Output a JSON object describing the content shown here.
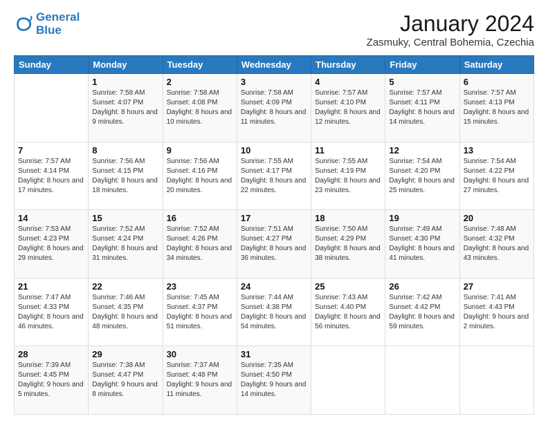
{
  "logo": {
    "line1": "General",
    "line2": "Blue"
  },
  "title": "January 2024",
  "subtitle": "Zasmuky, Central Bohemia, Czechia",
  "weekdays": [
    "Sunday",
    "Monday",
    "Tuesday",
    "Wednesday",
    "Thursday",
    "Friday",
    "Saturday"
  ],
  "weeks": [
    [
      {
        "day": "",
        "sunrise": "",
        "sunset": "",
        "daylight": ""
      },
      {
        "day": "1",
        "sunrise": "Sunrise: 7:58 AM",
        "sunset": "Sunset: 4:07 PM",
        "daylight": "Daylight: 8 hours and 9 minutes."
      },
      {
        "day": "2",
        "sunrise": "Sunrise: 7:58 AM",
        "sunset": "Sunset: 4:08 PM",
        "daylight": "Daylight: 8 hours and 10 minutes."
      },
      {
        "day": "3",
        "sunrise": "Sunrise: 7:58 AM",
        "sunset": "Sunset: 4:09 PM",
        "daylight": "Daylight: 8 hours and 11 minutes."
      },
      {
        "day": "4",
        "sunrise": "Sunrise: 7:57 AM",
        "sunset": "Sunset: 4:10 PM",
        "daylight": "Daylight: 8 hours and 12 minutes."
      },
      {
        "day": "5",
        "sunrise": "Sunrise: 7:57 AM",
        "sunset": "Sunset: 4:11 PM",
        "daylight": "Daylight: 8 hours and 14 minutes."
      },
      {
        "day": "6",
        "sunrise": "Sunrise: 7:57 AM",
        "sunset": "Sunset: 4:13 PM",
        "daylight": "Daylight: 8 hours and 15 minutes."
      }
    ],
    [
      {
        "day": "7",
        "sunrise": "Sunrise: 7:57 AM",
        "sunset": "Sunset: 4:14 PM",
        "daylight": "Daylight: 8 hours and 17 minutes."
      },
      {
        "day": "8",
        "sunrise": "Sunrise: 7:56 AM",
        "sunset": "Sunset: 4:15 PM",
        "daylight": "Daylight: 8 hours and 18 minutes."
      },
      {
        "day": "9",
        "sunrise": "Sunrise: 7:56 AM",
        "sunset": "Sunset: 4:16 PM",
        "daylight": "Daylight: 8 hours and 20 minutes."
      },
      {
        "day": "10",
        "sunrise": "Sunrise: 7:55 AM",
        "sunset": "Sunset: 4:17 PM",
        "daylight": "Daylight: 8 hours and 22 minutes."
      },
      {
        "day": "11",
        "sunrise": "Sunrise: 7:55 AM",
        "sunset": "Sunset: 4:19 PM",
        "daylight": "Daylight: 8 hours and 23 minutes."
      },
      {
        "day": "12",
        "sunrise": "Sunrise: 7:54 AM",
        "sunset": "Sunset: 4:20 PM",
        "daylight": "Daylight: 8 hours and 25 minutes."
      },
      {
        "day": "13",
        "sunrise": "Sunrise: 7:54 AM",
        "sunset": "Sunset: 4:22 PM",
        "daylight": "Daylight: 8 hours and 27 minutes."
      }
    ],
    [
      {
        "day": "14",
        "sunrise": "Sunrise: 7:53 AM",
        "sunset": "Sunset: 4:23 PM",
        "daylight": "Daylight: 8 hours and 29 minutes."
      },
      {
        "day": "15",
        "sunrise": "Sunrise: 7:52 AM",
        "sunset": "Sunset: 4:24 PM",
        "daylight": "Daylight: 8 hours and 31 minutes."
      },
      {
        "day": "16",
        "sunrise": "Sunrise: 7:52 AM",
        "sunset": "Sunset: 4:26 PM",
        "daylight": "Daylight: 8 hours and 34 minutes."
      },
      {
        "day": "17",
        "sunrise": "Sunrise: 7:51 AM",
        "sunset": "Sunset: 4:27 PM",
        "daylight": "Daylight: 8 hours and 36 minutes."
      },
      {
        "day": "18",
        "sunrise": "Sunrise: 7:50 AM",
        "sunset": "Sunset: 4:29 PM",
        "daylight": "Daylight: 8 hours and 38 minutes."
      },
      {
        "day": "19",
        "sunrise": "Sunrise: 7:49 AM",
        "sunset": "Sunset: 4:30 PM",
        "daylight": "Daylight: 8 hours and 41 minutes."
      },
      {
        "day": "20",
        "sunrise": "Sunrise: 7:48 AM",
        "sunset": "Sunset: 4:32 PM",
        "daylight": "Daylight: 8 hours and 43 minutes."
      }
    ],
    [
      {
        "day": "21",
        "sunrise": "Sunrise: 7:47 AM",
        "sunset": "Sunset: 4:33 PM",
        "daylight": "Daylight: 8 hours and 46 minutes."
      },
      {
        "day": "22",
        "sunrise": "Sunrise: 7:46 AM",
        "sunset": "Sunset: 4:35 PM",
        "daylight": "Daylight: 8 hours and 48 minutes."
      },
      {
        "day": "23",
        "sunrise": "Sunrise: 7:45 AM",
        "sunset": "Sunset: 4:37 PM",
        "daylight": "Daylight: 8 hours and 51 minutes."
      },
      {
        "day": "24",
        "sunrise": "Sunrise: 7:44 AM",
        "sunset": "Sunset: 4:38 PM",
        "daylight": "Daylight: 8 hours and 54 minutes."
      },
      {
        "day": "25",
        "sunrise": "Sunrise: 7:43 AM",
        "sunset": "Sunset: 4:40 PM",
        "daylight": "Daylight: 8 hours and 56 minutes."
      },
      {
        "day": "26",
        "sunrise": "Sunrise: 7:42 AM",
        "sunset": "Sunset: 4:42 PM",
        "daylight": "Daylight: 8 hours and 59 minutes."
      },
      {
        "day": "27",
        "sunrise": "Sunrise: 7:41 AM",
        "sunset": "Sunset: 4:43 PM",
        "daylight": "Daylight: 9 hours and 2 minutes."
      }
    ],
    [
      {
        "day": "28",
        "sunrise": "Sunrise: 7:39 AM",
        "sunset": "Sunset: 4:45 PM",
        "daylight": "Daylight: 9 hours and 5 minutes."
      },
      {
        "day": "29",
        "sunrise": "Sunrise: 7:38 AM",
        "sunset": "Sunset: 4:47 PM",
        "daylight": "Daylight: 9 hours and 8 minutes."
      },
      {
        "day": "30",
        "sunrise": "Sunrise: 7:37 AM",
        "sunset": "Sunset: 4:48 PM",
        "daylight": "Daylight: 9 hours and 11 minutes."
      },
      {
        "day": "31",
        "sunrise": "Sunrise: 7:35 AM",
        "sunset": "Sunset: 4:50 PM",
        "daylight": "Daylight: 9 hours and 14 minutes."
      },
      {
        "day": "",
        "sunrise": "",
        "sunset": "",
        "daylight": ""
      },
      {
        "day": "",
        "sunrise": "",
        "sunset": "",
        "daylight": ""
      },
      {
        "day": "",
        "sunrise": "",
        "sunset": "",
        "daylight": ""
      }
    ]
  ]
}
